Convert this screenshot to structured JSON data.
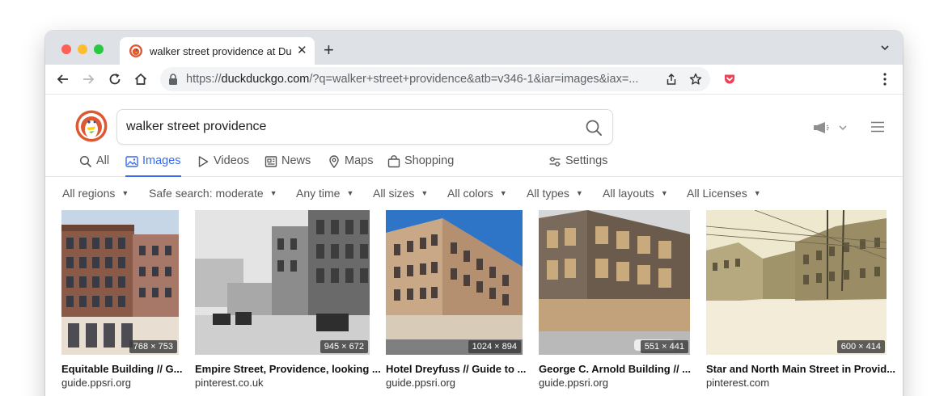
{
  "tab": {
    "title": "walker street providence at Du",
    "close": "✕",
    "new_tab": "+"
  },
  "toolbar": {
    "url_scheme": "https://",
    "url_host": "duckduckgo.com",
    "url_path": "/?q=walker+street+providence&atb=v346-1&iar=images&iax=..."
  },
  "search": {
    "query": "walker street providence"
  },
  "nav_tabs": [
    {
      "label": "All",
      "icon": "search-icon",
      "active": false
    },
    {
      "label": "Images",
      "icon": "image-icon",
      "active": true
    },
    {
      "label": "Videos",
      "icon": "play-icon",
      "active": false
    },
    {
      "label": "News",
      "icon": "newspaper-icon",
      "active": false
    },
    {
      "label": "Maps",
      "icon": "map-pin-icon",
      "active": false
    },
    {
      "label": "Shopping",
      "icon": "shopping-bag-icon",
      "active": false
    },
    {
      "label": "Settings",
      "icon": "settings-sliders-icon",
      "active": false
    }
  ],
  "filters": [
    {
      "label": "All regions",
      "caret": "▼"
    },
    {
      "label": "Safe search: moderate",
      "caret": "▼"
    },
    {
      "label": "Any time",
      "caret": "▼"
    },
    {
      "label": "All sizes",
      "caret": "▼"
    },
    {
      "label": "All colors",
      "caret": "▼"
    },
    {
      "label": "All types",
      "caret": "▼"
    },
    {
      "label": "All layouts",
      "caret": "▼"
    },
    {
      "label": "All Licenses",
      "caret": "▼"
    }
  ],
  "results": [
    {
      "title": "Equitable Building // G...",
      "source": "guide.ppsri.org",
      "dimensions": "768 × 753"
    },
    {
      "title": "Empire Street, Providence, looking ...",
      "source": "pinterest.co.uk",
      "dimensions": "945 × 672"
    },
    {
      "title": "Hotel Dreyfuss // Guide to ...",
      "source": "guide.ppsri.org",
      "dimensions": "1024 × 894"
    },
    {
      "title": "George C. Arnold Building // ...",
      "source": "guide.ppsri.org",
      "dimensions": "551 × 441"
    },
    {
      "title": "Star and North Main Street in Provid...",
      "source": "pinterest.com",
      "dimensions": "600 × 414"
    }
  ],
  "colors": {
    "accent": "#3969ef",
    "ddg_orange": "#de5833",
    "pocket_red": "#ef4056"
  }
}
